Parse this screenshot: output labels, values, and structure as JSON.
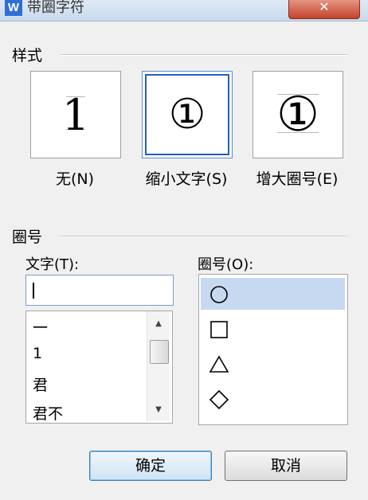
{
  "dialog": {
    "title": "带圈字符",
    "app_icon": "W",
    "close_glyph": "✕"
  },
  "style_section": {
    "label": "样式",
    "options": [
      {
        "glyph": "1",
        "label": "无(N)",
        "selected": false
      },
      {
        "glyph": "①",
        "label": "缩小文字(S)",
        "selected": true
      },
      {
        "glyph": "①",
        "label": "增大圈号(E)",
        "selected": false
      }
    ]
  },
  "enclosure_section": {
    "label": "圈号",
    "text_label": "文字(T):",
    "text_value": "",
    "text_list": [
      "一",
      "1",
      "君",
      "君不"
    ],
    "enclosure_label": "圈号(O):",
    "enclosure_list": [
      {
        "icon": "circle-icon",
        "selected": true
      },
      {
        "icon": "square-icon",
        "selected": false
      },
      {
        "icon": "triangle-icon",
        "selected": false
      },
      {
        "icon": "diamond-icon",
        "selected": false
      }
    ]
  },
  "buttons": {
    "ok": "确定",
    "cancel": "取消"
  },
  "colors": {
    "selection": "#c7d9f1",
    "accent_border": "#1f5fc0",
    "close_button": "#c5432a"
  }
}
